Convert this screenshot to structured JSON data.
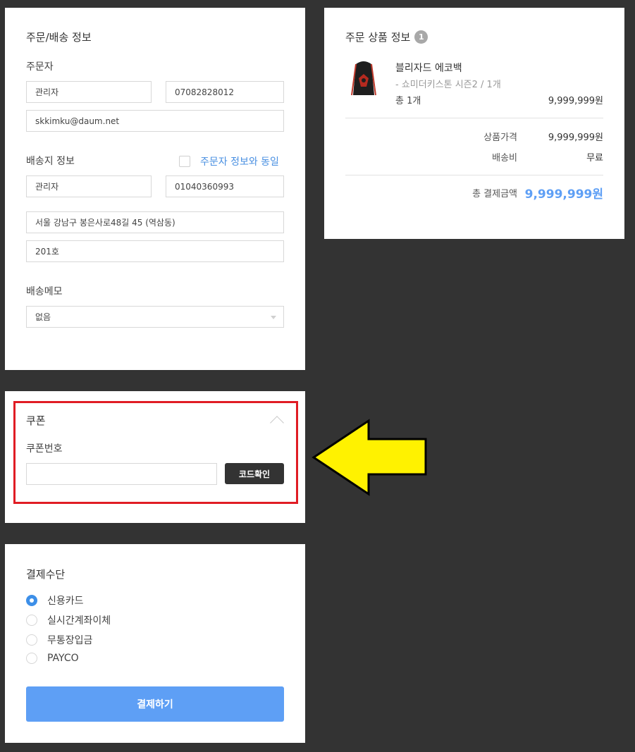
{
  "order": {
    "section_title": "주문/배송 정보",
    "orderer_label": "주문자",
    "orderer_name": "관리자",
    "orderer_phone": "07082828012",
    "orderer_email": "skkimku@daum.net",
    "shipping_label": "배송지 정보",
    "same_as_orderer": "주문자 정보와 동일",
    "shipping_name": "관리자",
    "shipping_phone": "01040360993",
    "address": "서울 강남구 봉은사로48길 45 (역삼동)",
    "address_detail": "201호",
    "memo_label": "배송메모",
    "memo_value": "없음"
  },
  "coupon": {
    "section_title": "쿠폰",
    "code_label": "쿠폰번호",
    "code_value": "",
    "check_button": "코드확인"
  },
  "payment": {
    "section_title": "결제수단",
    "methods": [
      {
        "label": "신용카드",
        "selected": true
      },
      {
        "label": "실시간계좌이체",
        "selected": false
      },
      {
        "label": "무통장입금",
        "selected": false
      },
      {
        "label": "PAYCO",
        "selected": false
      }
    ],
    "pay_button": "결제하기"
  },
  "summary": {
    "section_title": "주문 상품 정보",
    "item_count": "1",
    "product_name": "블리자드 에코백",
    "product_option": "- 쇼미더키스톤 시즌2 / 1개",
    "product_qty": "총 1개",
    "product_price": "9,999,999원",
    "price_label": "상품가격",
    "price_value": "9,999,999원",
    "shipping_label": "배송비",
    "shipping_value": "무료",
    "total_label": "총 결제금액",
    "total_value": "9,999,999원"
  },
  "colors": {
    "accent_blue": "#5e9ff5",
    "highlight_red": "#e01c24",
    "arrow_yellow": "#fff200",
    "background": "#333333"
  }
}
